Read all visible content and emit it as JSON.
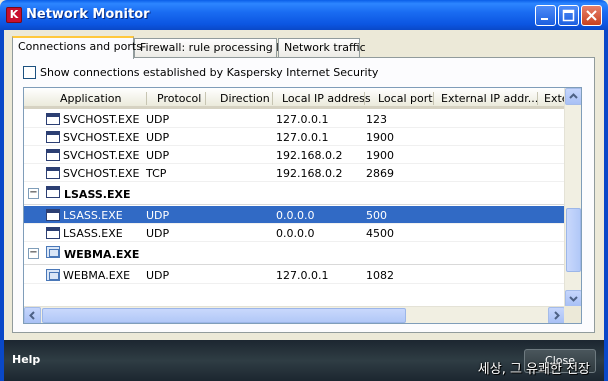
{
  "window": {
    "logo_letter": "K",
    "title": "Network Monitor"
  },
  "tabs": [
    {
      "label": "Connections and ports",
      "active": true
    },
    {
      "label": "Firewall: rule processing log",
      "active": false
    },
    {
      "label": "Network traffic",
      "active": false
    }
  ],
  "filter": {
    "label": "Show connections established by Kaspersky Internet Security",
    "checked": false
  },
  "columns": [
    "Application",
    "Protocol",
    "Direction",
    "Local IP address",
    "Local port",
    "External IP addr...",
    "Exte"
  ],
  "rows_svchost": [
    {
      "app": "SVCHOST.EXE",
      "protocol": "UDP",
      "local_ip": "127.0.0.1",
      "local_port": "123"
    },
    {
      "app": "SVCHOST.EXE",
      "protocol": "UDP",
      "local_ip": "127.0.0.1",
      "local_port": "1900"
    },
    {
      "app": "SVCHOST.EXE",
      "protocol": "UDP",
      "local_ip": "192.168.0.2",
      "local_port": "1900"
    },
    {
      "app": "SVCHOST.EXE",
      "protocol": "TCP",
      "local_ip": "192.168.0.2",
      "local_port": "2869"
    }
  ],
  "group_lsass": {
    "expander": "−",
    "label": "LSASS.EXE"
  },
  "rows_lsass": [
    {
      "app": "LSASS.EXE",
      "protocol": "UDP",
      "local_ip": "0.0.0.0",
      "local_port": "500",
      "selected": true
    },
    {
      "app": "LSASS.EXE",
      "protocol": "UDP",
      "local_ip": "0.0.0.0",
      "local_port": "4500",
      "selected": false
    }
  ],
  "group_webma": {
    "expander": "−",
    "label": "WEBMA.EXE"
  },
  "rows_webma": [
    {
      "app": "WEBMA.EXE",
      "protocol": "UDP",
      "local_ip": "127.0.0.1",
      "local_port": "1082"
    }
  ],
  "footer": {
    "help_label": "Help",
    "close_label": "Close",
    "watermark": "세상, 그 유쾌한 전장"
  },
  "colors": {
    "titlebar": "#0a5ee8",
    "selection": "#316ac5",
    "footer": "#2f3d44"
  }
}
